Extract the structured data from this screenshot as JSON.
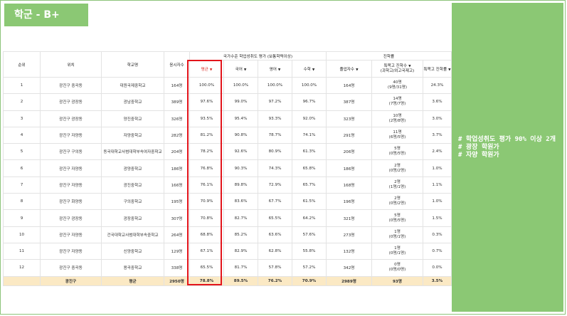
{
  "title": "학군 - B+",
  "notes": [
    "# 학업성취도 평가 90% 이상 2개",
    "# 광장 학원가",
    "# 자양 학원가"
  ],
  "header": {
    "rank": "순위",
    "location": "위치",
    "school": "학교명",
    "test_takers": "응시자수",
    "national_group": "국가수준 학업성취도 평가 (보통학력이상)",
    "avg": "평균",
    "korean": "국어",
    "english": "영어",
    "math": "수학",
    "advance_group": "진학률",
    "graduates": "졸업자수",
    "special_l1": "특목고 진학수",
    "special_l2": "(과학고/외고국제고)",
    "special_rate": "특목고 진학률"
  },
  "rows": [
    {
      "rank": "1",
      "loc": "광진구 중곡동",
      "school": "대원국제중학교",
      "takers": "164명",
      "avg": "100.0%",
      "kor": "100.0%",
      "eng": "100.0%",
      "math": "100.0%",
      "grad": "164명",
      "sp1": "40명",
      "sp2": "(9명/31명)",
      "rate": "24.3%"
    },
    {
      "rank": "2",
      "loc": "광진구 광장동",
      "school": "광남중학교",
      "takers": "389명",
      "avg": "97.6%",
      "kor": "99.0%",
      "eng": "97.2%",
      "math": "96.7%",
      "grad": "387명",
      "sp1": "14명",
      "sp2": "(7명/7명)",
      "rate": "3.6%"
    },
    {
      "rank": "3",
      "loc": "광진구 광장동",
      "school": "양진중학교",
      "takers": "326명",
      "avg": "93.5%",
      "kor": "95.4%",
      "eng": "93.3%",
      "math": "92.0%",
      "grad": "323명",
      "sp1": "10명",
      "sp2": "(2명/8명)",
      "rate": "3.0%"
    },
    {
      "rank": "4",
      "loc": "광진구 자양동",
      "school": "자양중학교",
      "takers": "282명",
      "avg": "81.2%",
      "kor": "90.8%",
      "eng": "78.7%",
      "math": "74.1%",
      "grad": "291명",
      "sp1": "11명",
      "sp2": "(6명/5명)",
      "rate": "3.7%"
    },
    {
      "rank": "5",
      "loc": "광진구 구의동",
      "school": "동국대학교사범대학부속여자중학교",
      "takers": "204명",
      "avg": "78.2%",
      "kor": "92.6%",
      "eng": "80.9%",
      "math": "61.3%",
      "grad": "206명",
      "sp1": "5명",
      "sp2": "(0명/5명)",
      "rate": "2.4%"
    },
    {
      "rank": "6",
      "loc": "광진구 자양동",
      "school": "광양중학교",
      "takers": "186명",
      "avg": "76.8%",
      "kor": "90.3%",
      "eng": "74.3%",
      "math": "65.8%",
      "grad": "186명",
      "sp1": "2명",
      "sp2": "(0명/2명)",
      "rate": "1.0%"
    },
    {
      "rank": "7",
      "loc": "광진구 자양동",
      "school": "광진중학교",
      "takers": "166명",
      "avg": "76.1%",
      "kor": "89.8%",
      "eng": "72.9%",
      "math": "65.7%",
      "grad": "168명",
      "sp1": "2명",
      "sp2": "(1명/1명)",
      "rate": "1.1%"
    },
    {
      "rank": "8",
      "loc": "광진구 화양동",
      "school": "구의중학교",
      "takers": "195명",
      "avg": "70.9%",
      "kor": "83.6%",
      "eng": "67.7%",
      "math": "61.5%",
      "grad": "196명",
      "sp1": "2명",
      "sp2": "(0명/2명)",
      "rate": "1.0%"
    },
    {
      "rank": "9",
      "loc": "광진구 광장동",
      "school": "광장중학교",
      "takers": "307명",
      "avg": "70.8%",
      "kor": "82.7%",
      "eng": "65.5%",
      "math": "64.2%",
      "grad": "321명",
      "sp1": "5명",
      "sp2": "(0명/5명)",
      "rate": "1.5%"
    },
    {
      "rank": "10",
      "loc": "광진구 자양동",
      "school": "건국대학교사범대학부속중학교",
      "takers": "264명",
      "avg": "68.8%",
      "kor": "85.2%",
      "eng": "63.6%",
      "math": "57.6%",
      "grad": "273명",
      "sp1": "1명",
      "sp2": "(0명/1명)",
      "rate": "0.3%"
    },
    {
      "rank": "11",
      "loc": "광진구 자양동",
      "school": "신양중학교",
      "takers": "129명",
      "avg": "67.1%",
      "kor": "82.9%",
      "eng": "62.8%",
      "math": "55.8%",
      "grad": "132명",
      "sp1": "1명",
      "sp2": "(0명/1명)",
      "rate": "0.7%"
    },
    {
      "rank": "12",
      "loc": "광진구 중곡동",
      "school": "용곡중학교",
      "takers": "338명",
      "avg": "65.5%",
      "kor": "81.7%",
      "eng": "57.8%",
      "math": "57.2%",
      "grad": "342명",
      "sp1": "0명",
      "sp2": "(0명/0명)",
      "rate": "0.0%"
    }
  ],
  "footer": {
    "loc": "광진구",
    "school": "평균",
    "takers": "2950명",
    "avg": "78.8%",
    "kor": "89.5%",
    "eng": "76.2%",
    "math": "70.9%",
    "grad": "2989명",
    "sp": "93명",
    "rate": "3.5%"
  },
  "colors": {
    "accent_green": "#8bc874",
    "highlight_red": "#e3141b",
    "footer_bg": "#fbe9c4"
  }
}
